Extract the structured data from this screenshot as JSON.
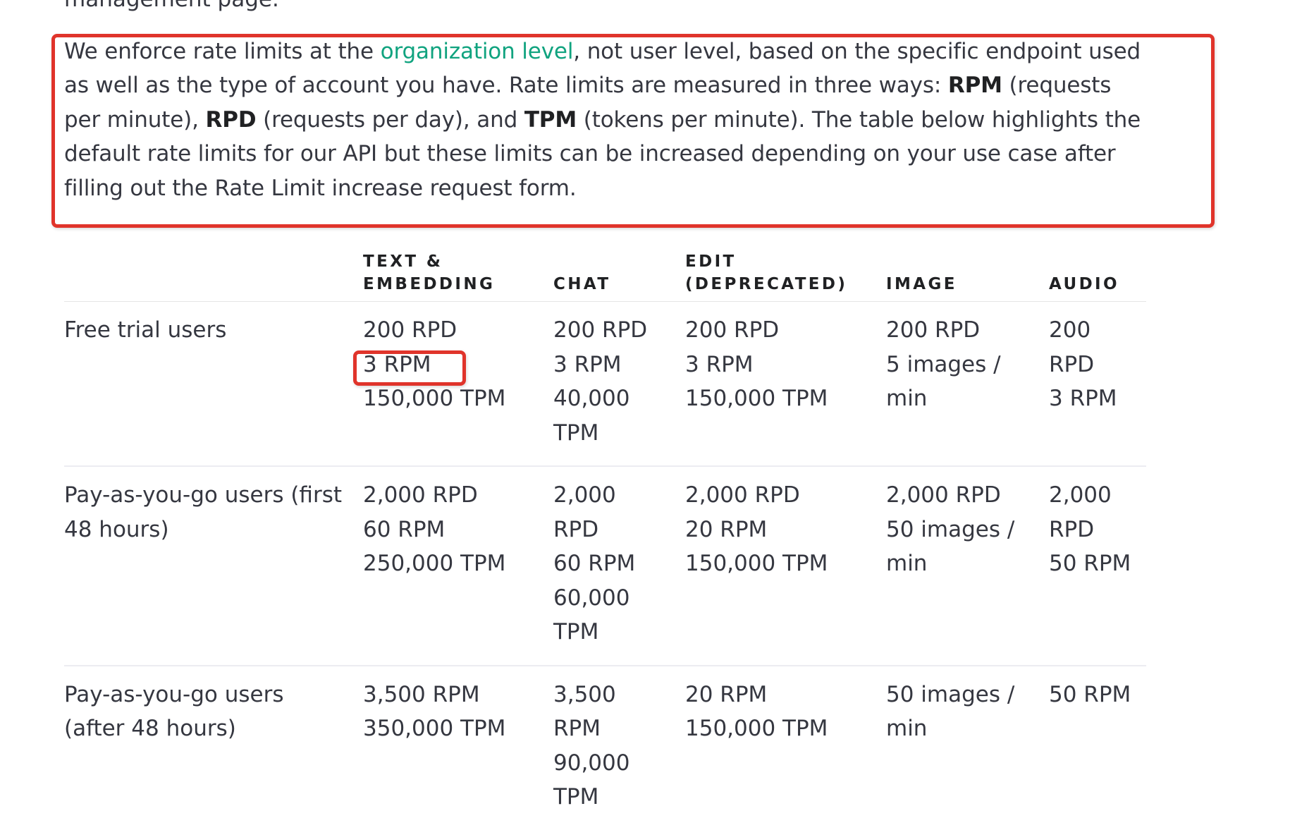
{
  "top_fragment": "management page.",
  "intro": {
    "text_before_link": "We enforce rate limits at the ",
    "link_text": "organization level",
    "text_after_link": ", not user level, based on the specific endpoint used as well as the type of account you have. Rate limits are measured in three ways: ",
    "rpm_label": "RPM",
    "rpm_desc": " (requests per minute), ",
    "rpd_label": "RPD",
    "rpd_desc": " (requests per day), and ",
    "tpm_label": "TPM",
    "tpm_desc": " (tokens per minute). The table below highlights the default rate limits for our API but these limits can be increased depending on your use case after filling out the Rate Limit increase request form."
  },
  "table": {
    "headers": [
      "",
      "TEXT &\nEMBEDDING",
      "CHAT",
      "EDIT\n(DEPRECATED)",
      "IMAGE",
      "AUDIO"
    ],
    "rows": [
      {
        "label": "Free trial users",
        "text_embedding": [
          "200 RPD",
          "3 RPM",
          "150,000 TPM"
        ],
        "chat": "200 RPD\n3 RPM\n40,000\nTPM",
        "edit": "200 RPD\n3 RPM\n150,000 TPM",
        "image": "200 RPD\n5 images /\nmin",
        "audio": "200 RPD\n3 RPM"
      },
      {
        "label": "Pay-as-you-go users (first 48 hours)",
        "text_embedding": "2,000 RPD\n60 RPM\n250,000 TPM",
        "chat": "2,000\nRPD\n60 RPM\n60,000\nTPM",
        "edit": "2,000 RPD\n20 RPM\n150,000 TPM",
        "image": "2,000 RPD\n50 images /\nmin",
        "audio": "2,000\nRPD\n50 RPM"
      },
      {
        "label": "Pay-as-you-go users (after 48 hours)",
        "text_embedding": "3,500 RPM\n350,000 TPM",
        "chat": "3,500\nRPM\n90,000\nTPM",
        "edit": "20 RPM\n150,000 TPM",
        "image": "50 images /\nmin",
        "audio": "50 RPM"
      }
    ]
  },
  "annotation_colors": {
    "highlight_border": "#e0342b",
    "link": "#10a37f"
  }
}
